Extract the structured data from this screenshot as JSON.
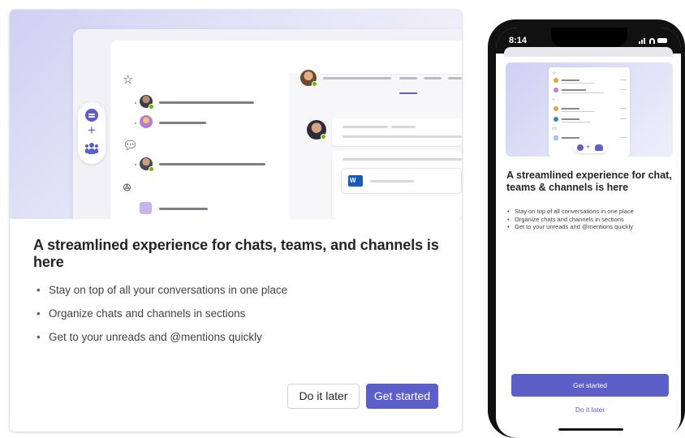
{
  "desktop": {
    "title": "A streamlined experience for chats, teams, and channels is here",
    "bullets": [
      "Stay on top of all your conversations in one place",
      "Organize chats and channels in sections",
      "Get to your unreads and @mentions quickly"
    ],
    "later_button": "Do it later",
    "start_button": "Get started"
  },
  "phone": {
    "time": "8:14",
    "title": "A streamlined experience for chat, teams & channels is here",
    "bullets": [
      "Stay on top of all conversations in one place",
      "Organize chats and channels in sections",
      "Get to your unreads and @mentions quickly"
    ],
    "start_button": "Get started",
    "later_button": "Do it later"
  },
  "colors": {
    "brand": "#5b5fc7",
    "hero_bg": "#dedff7",
    "presence": "#6bb700",
    "word": "#185abd"
  },
  "icons": [
    "star-icon",
    "chat-icon",
    "teams-icon",
    "plus-icon",
    "word-doc-icon",
    "signal-icon",
    "wifi-icon",
    "battery-icon"
  ]
}
